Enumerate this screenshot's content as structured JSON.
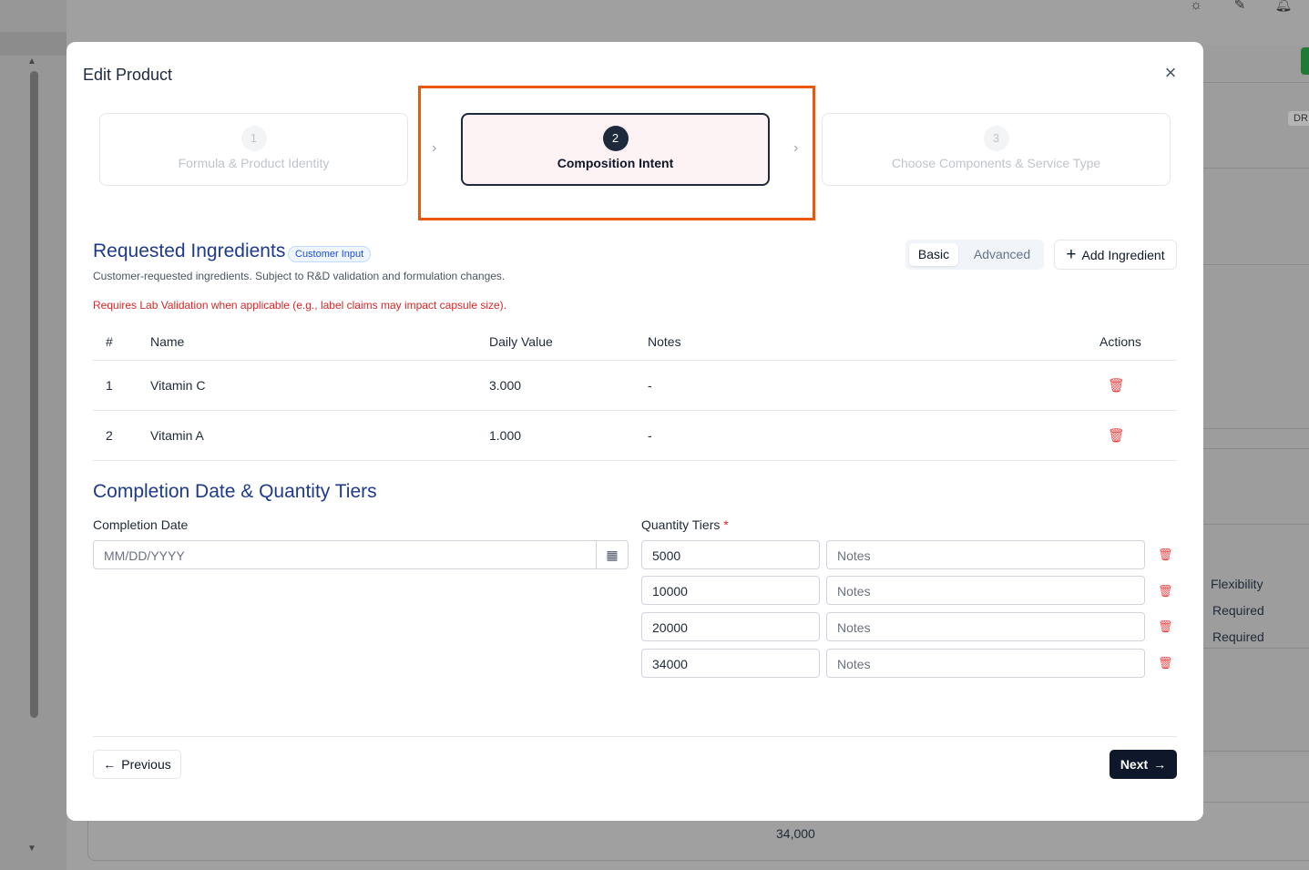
{
  "background": {
    "right_panel": {
      "column_header": "Flexibility",
      "rows": [
        "Required",
        "Required"
      ],
      "badge": "DR"
    },
    "bottom_value": "34,000"
  },
  "modal": {
    "title": "Edit Product",
    "stepper": [
      {
        "number": "1",
        "label": "Formula & Product Identity",
        "state": "inactive"
      },
      {
        "number": "2",
        "label": "Composition Intent",
        "state": "active"
      },
      {
        "number": "3",
        "label": "Choose Components & Service Type",
        "state": "inactive"
      }
    ],
    "ingredients": {
      "title": "Requested Ingredients",
      "badge": "Customer Input",
      "subtitle": "Customer-requested ingredients. Subject to R&D validation and formulation changes.",
      "warning": "Requires Lab Validation when applicable (e.g., label claims may impact capsule size).",
      "mode_toggle": {
        "basic": "Basic",
        "advanced": "Advanced",
        "selected": "Basic"
      },
      "add_button": "Add Ingredient",
      "columns": {
        "num": "#",
        "name": "Name",
        "daily_value": "Daily Value",
        "notes": "Notes",
        "actions": "Actions"
      },
      "rows": [
        {
          "num": "1",
          "name": "Vitamin C",
          "daily_value": "3.000",
          "notes": "-"
        },
        {
          "num": "2",
          "name": "Vitamin A",
          "daily_value": "1.000",
          "notes": "-"
        }
      ]
    },
    "completion": {
      "title": "Completion Date & Quantity Tiers",
      "date_label": "Completion Date",
      "date_placeholder": "MM/DD/YYYY",
      "tiers_label": "Quantity Tiers",
      "required_mark": "*",
      "notes_placeholder": "Notes",
      "tiers": [
        "5000",
        "10000",
        "20000",
        "34000"
      ]
    },
    "footer": {
      "previous": "Previous",
      "next": "Next"
    }
  },
  "colors": {
    "accent_title": "#1e3a8a",
    "highlight": "#ea580c",
    "danger": "#ef4444",
    "primary_button": "#0f172a"
  }
}
